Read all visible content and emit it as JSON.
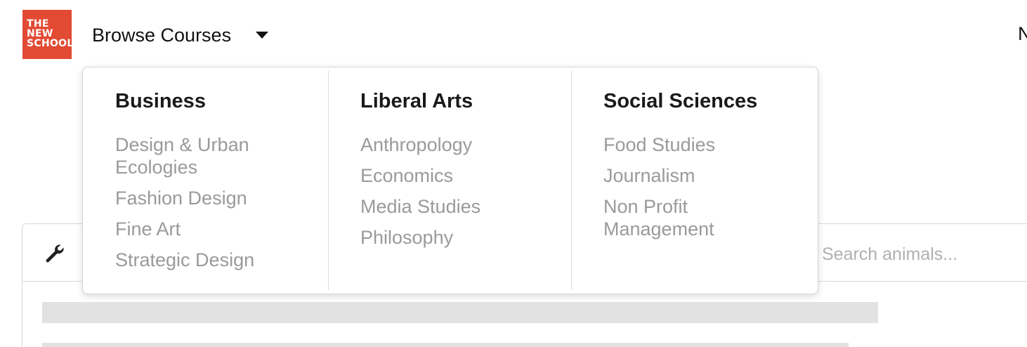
{
  "header": {
    "logo_lines": [
      "THE",
      "NEW",
      "SCHOOL"
    ],
    "browse_label": "Browse Courses",
    "right_nav_partial": "N"
  },
  "toolbar": {
    "search_placeholder": "Search animals..."
  },
  "dropdown": {
    "columns": [
      {
        "title": "Business",
        "items": [
          "Design & Urban Ecologies",
          "Fashion Design",
          "Fine Art",
          "Strategic Design"
        ]
      },
      {
        "title": "Liberal Arts",
        "items": [
          "Anthropology",
          "Economics",
          "Media Studies",
          "Philosophy"
        ]
      },
      {
        "title": "Social Sciences",
        "items": [
          "Food Studies",
          "Journalism",
          "Non Profit Management"
        ]
      }
    ]
  },
  "colors": {
    "brand_red": "#e24a33",
    "heading": "#1a1a1a",
    "link_muted": "#9a9a9a"
  }
}
